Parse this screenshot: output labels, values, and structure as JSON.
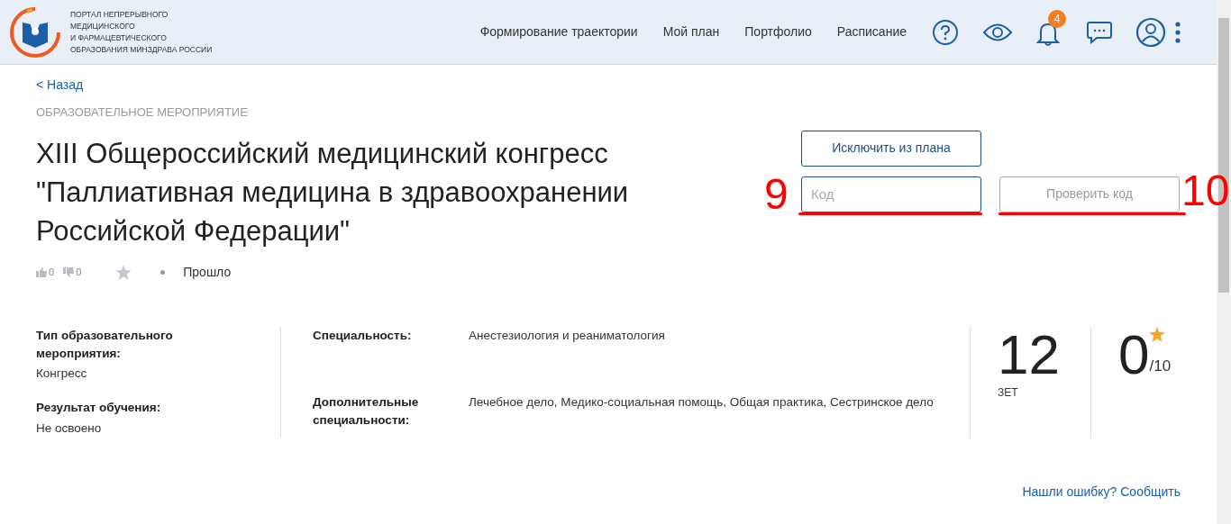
{
  "header": {
    "logo_text": [
      "ПОРТАЛ НЕПРЕРЫВНОГО",
      "МЕДИЦИНСКОГО",
      "И ФАРМАЦЕВТИЧЕСКОГО",
      "ОБРАЗОВАНИЯ МИНЗДРАВА РОССИИ"
    ],
    "nav": [
      "Формирование траектории",
      "Мой план",
      "Портфолио",
      "Расписание"
    ],
    "notifications_badge": "4"
  },
  "back_link": "< Назад",
  "category": "ОБРАЗОВАТЕЛЬНОЕ МЕРОПРИЯТИЕ",
  "title": "XIII Общероссийский медицинский конгресс \"Паллиативная медицина в здравоохранении Российской Федерации\"",
  "likes": "0",
  "dislikes": "0",
  "status": "Прошло",
  "actions": {
    "exclude_button": "Исключить из плана",
    "code_field": {
      "placeholder": "Код"
    },
    "check_button": {
      "label": "Проверить код",
      "disabled": true
    }
  },
  "info_left": [
    {
      "label": "Тип образовательного мероприятия:",
      "value": "Конгресс"
    },
    {
      "label": "Результат обучения:",
      "value": "Не освоено"
    }
  ],
  "info_mid": [
    {
      "label": "Специальность:",
      "value": "Анестезиология и реаниматология"
    },
    {
      "label": "Дополнительные специальности:",
      "value": "Лечебное дело, Медико-социальная помощь, Общая практика, Сестринское дело"
    }
  ],
  "credits": {
    "value": "12",
    "unit": "ЗЕТ"
  },
  "rating": {
    "value": "0",
    "max": "/10"
  },
  "report_link": "Нашли ошибку? Сообщить",
  "annotations": [
    {
      "label": "9"
    },
    {
      "label": "10"
    }
  ]
}
